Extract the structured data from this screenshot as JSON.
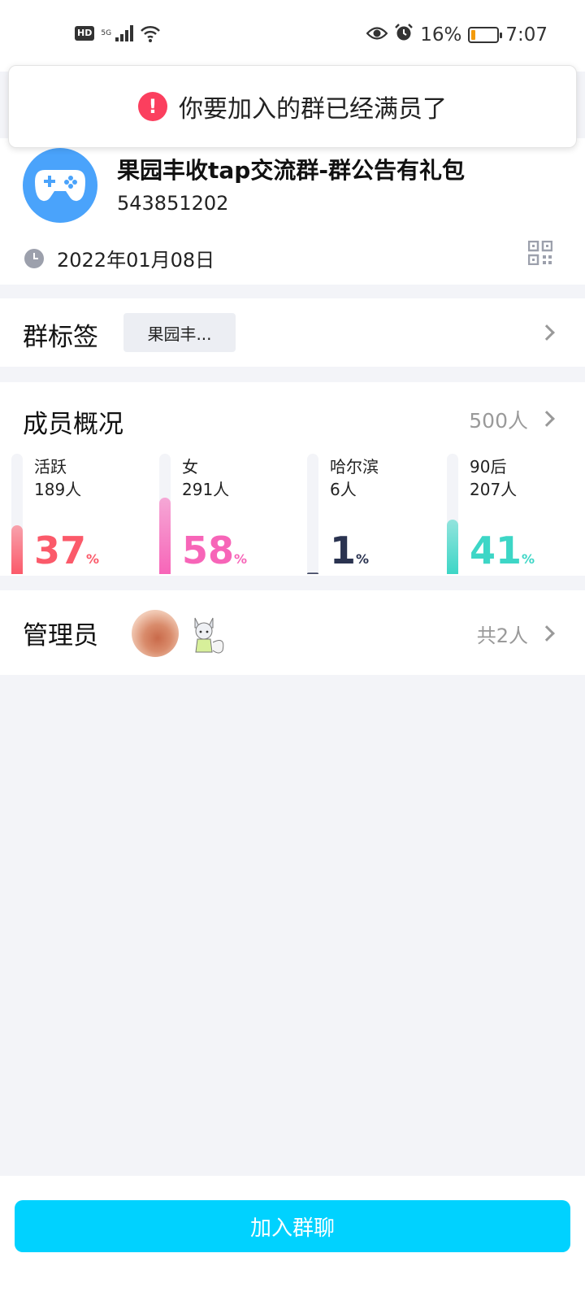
{
  "status_bar": {
    "hd": "HD",
    "network": "5G",
    "battery_percent": "16%",
    "battery_level": 0.16,
    "time": "7:07",
    "icons": [
      "wifi-icon",
      "eye-icon",
      "alarm-icon",
      "battery-icon"
    ]
  },
  "toast": {
    "icon": "exclamation",
    "message": "你要加入的群已经满员了"
  },
  "group": {
    "name": "果园丰收tap交流群-群公告有礼包",
    "id": "543851202",
    "created_date": "2022年01月08日",
    "avatar_icon": "gamepad-icon"
  },
  "tags_section": {
    "title": "群标签",
    "tag": "果园丰..."
  },
  "members_section": {
    "title": "成员概况",
    "total": "500人",
    "stats": [
      {
        "label": "活跃",
        "count": "189人",
        "percent": "37",
        "unit": "%",
        "color": "#fb5a6a",
        "fill": 0.37
      },
      {
        "label": "女",
        "count": "291人",
        "percent": "58",
        "unit": "%",
        "color": "#f765b8",
        "fill": 0.58
      },
      {
        "label": "哈尔滨",
        "count": "6人",
        "percent": "1",
        "unit": "%",
        "color": "#2a3350",
        "fill": 0.01
      },
      {
        "label": "90后",
        "count": "207人",
        "percent": "41",
        "unit": "%",
        "color": "#3dd6c6",
        "fill": 0.41
      }
    ]
  },
  "admin_section": {
    "title": "管理员",
    "total": "共2人"
  },
  "join_button": {
    "label": "加入群聊",
    "color": "#00d2ff"
  }
}
